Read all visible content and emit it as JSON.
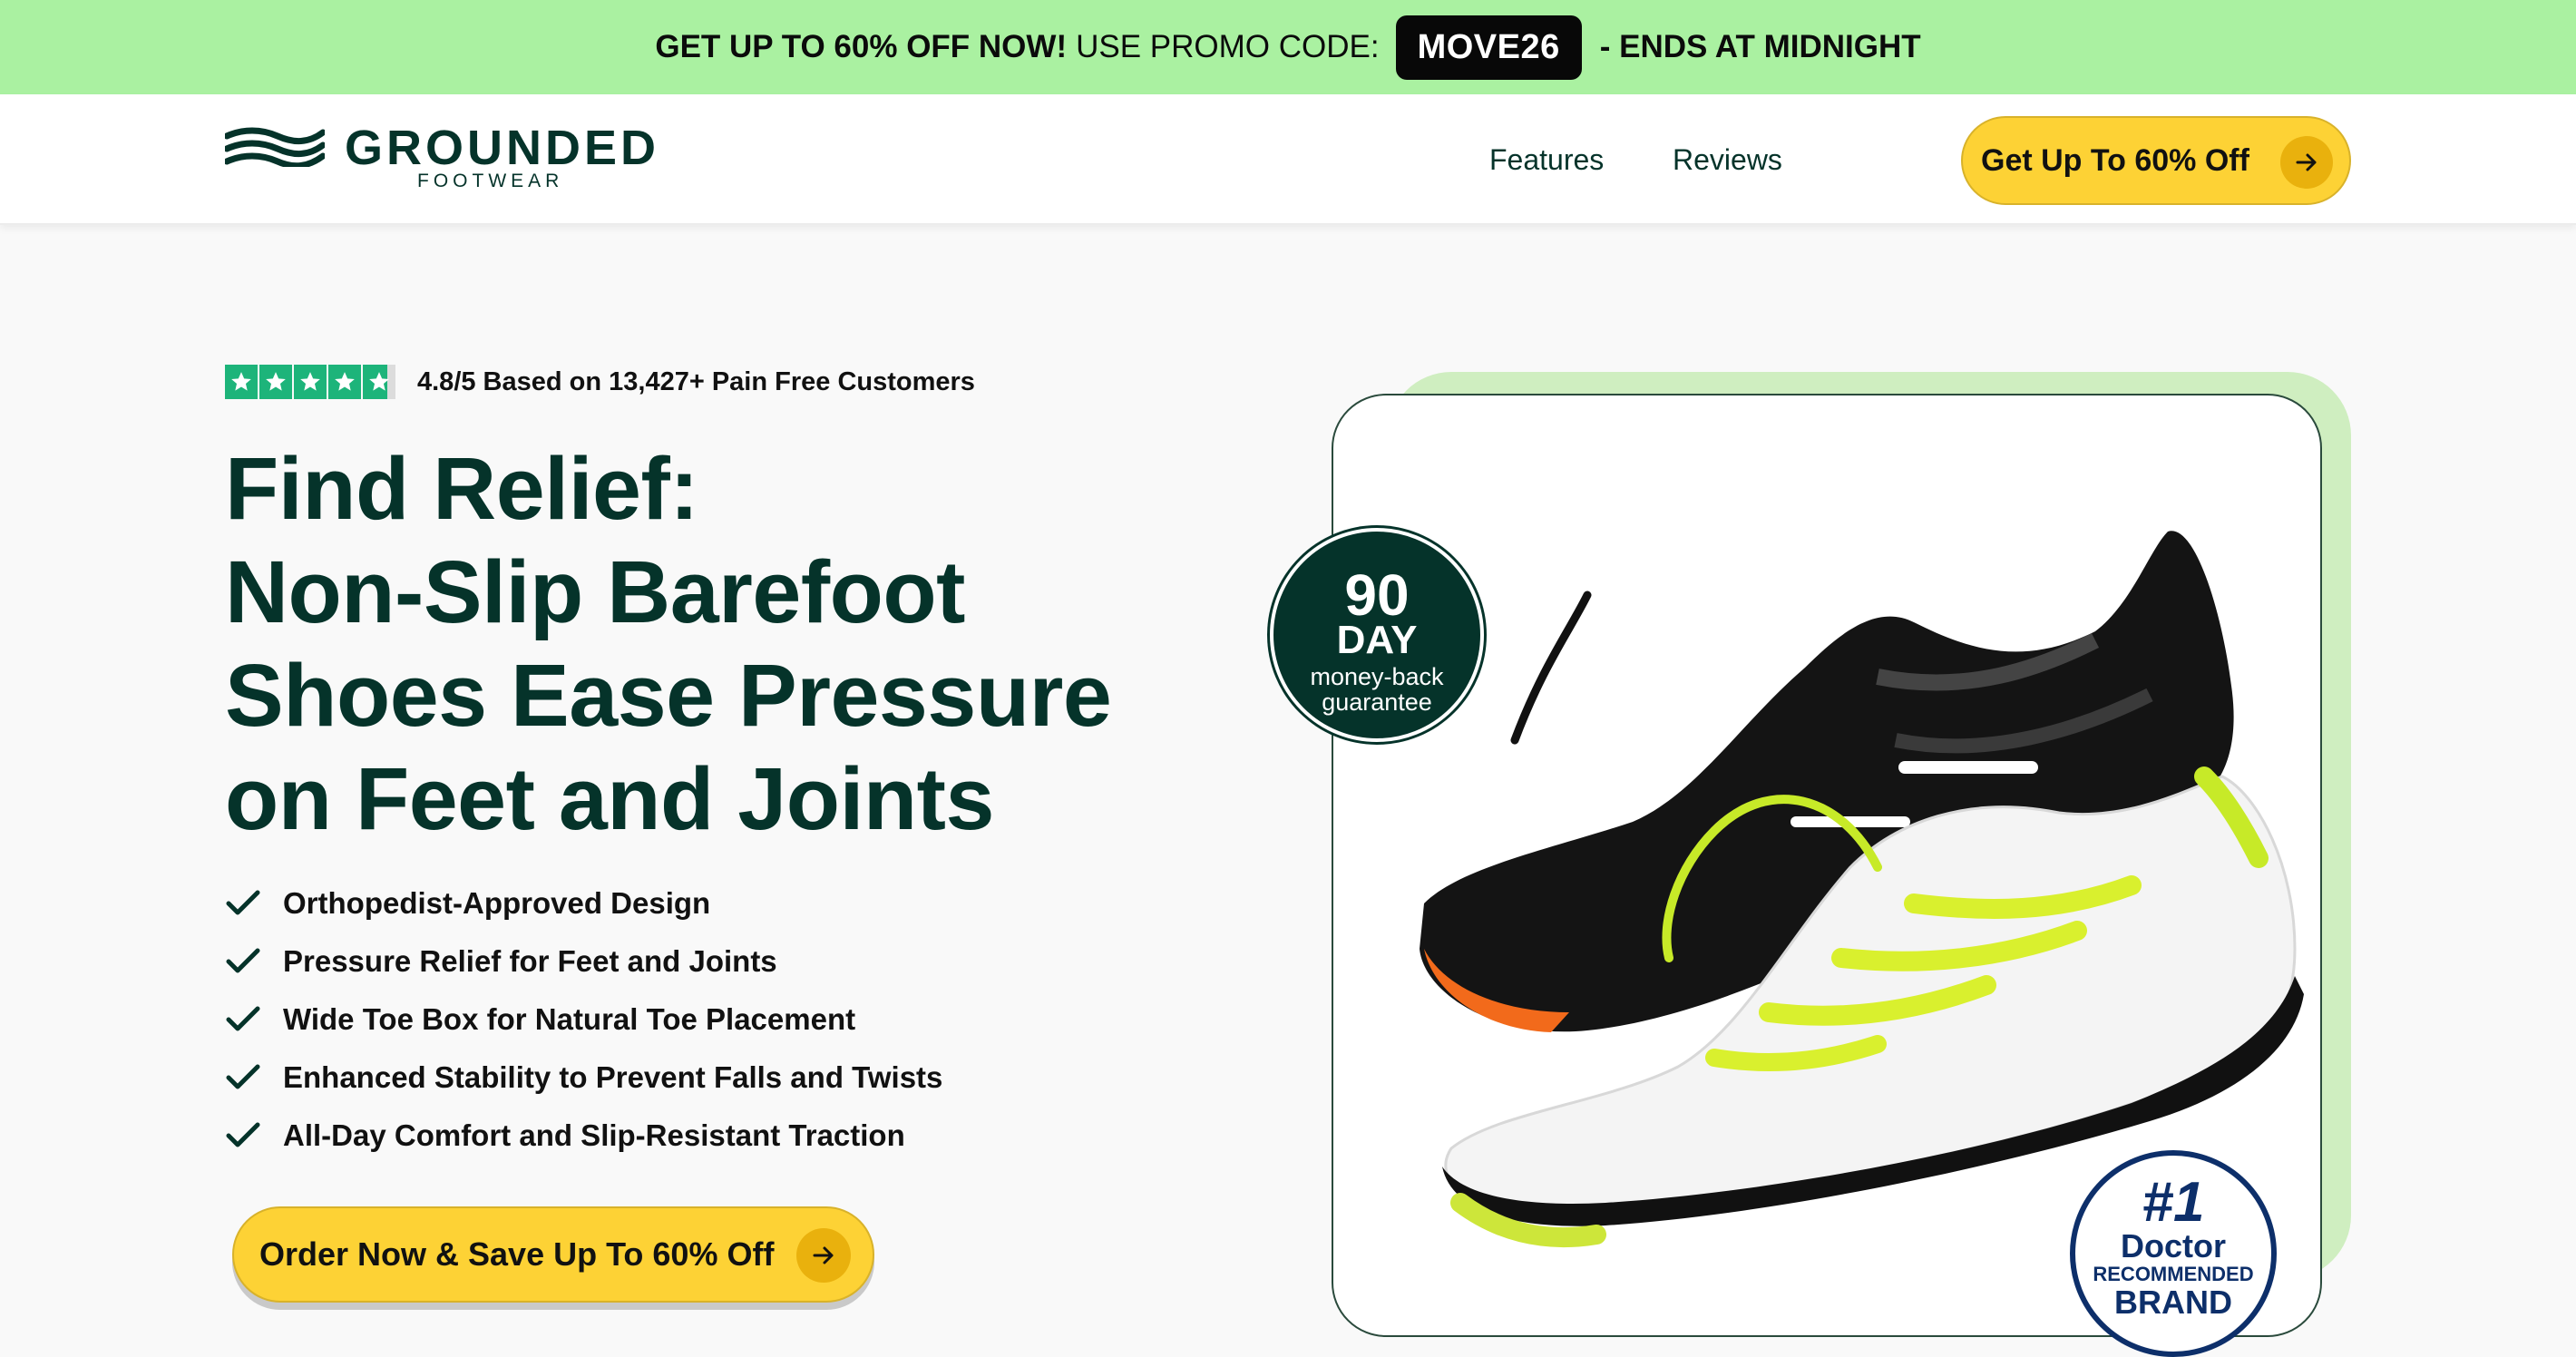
{
  "promo": {
    "lead": "GET UP TO 60% OFF NOW!",
    "middle": "USE PROMO CODE:",
    "code": "MOVE26",
    "tail": "- ENDS AT MIDNIGHT"
  },
  "brand": {
    "name": "GROUNDED",
    "sub": "FOOTWEAR"
  },
  "nav": {
    "links": [
      "Features",
      "Reviews"
    ],
    "cta_label": "Get Up To 60% Off"
  },
  "hero": {
    "rating_text": "4.8/5 Based on 13,427+ Pain Free Customers",
    "rating_stars": 4.8,
    "headline_lines": [
      "Find Relief:",
      "Non-Slip Barefoot",
      "Shoes Ease Pressure",
      "on Feet and Joints"
    ],
    "features": [
      "Orthopedist-Approved Design",
      "Pressure Relief for Feet and Joints",
      "Wide Toe Box for Natural Toe Placement",
      "Enhanced Stability to Prevent Falls and Twists",
      "All-Day Comfort and Slip-Resistant Traction"
    ],
    "cta_label": "Order Now & Save Up To 60% Off"
  },
  "badges": {
    "guarantee_number": "90",
    "guarantee_unit": "DAY",
    "guarantee_text_1": "money-back",
    "guarantee_text_2": "guarantee",
    "rank": "#1",
    "rank_line1": "Doctor",
    "rank_line2": "RECOMMENDED",
    "rank_line3": "BRAND"
  },
  "colors": {
    "promo_bg": "#aaf1a1",
    "brand_dark": "#05332a",
    "accent_yellow": "#fdd235",
    "star_green": "#1db47a",
    "badge_blue": "#0d2f6a"
  }
}
